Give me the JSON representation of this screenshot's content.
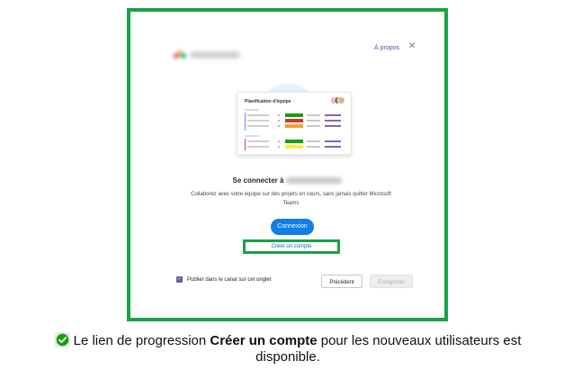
{
  "dialog": {
    "about_label": "À propos",
    "close_glyph": "✕",
    "card": {
      "title": "Planification d'équipe"
    },
    "connect": {
      "title_prefix": "Se connecter à",
      "description": "Collaborez avec votre équipe sur des projets en cours, sans jamais quitter Microsoft Teams"
    },
    "buttons": {
      "connexion": "Connexion",
      "create_account": "Créer un compte",
      "previous": "Précédent",
      "save": "Enregistrer"
    },
    "checkbox": {
      "label": "Publier dans le canal sur cet onglet",
      "checked": true
    }
  },
  "caption": {
    "prefix": "Le lien de progression ",
    "bold": "Créer un compte",
    "suffix": " pour les nouveaux utilisateurs est disponible."
  },
  "colors": {
    "highlight": "#17a344",
    "primary": "#0f7ee6",
    "link": "#0f6cbd",
    "status_green": "#13a10e",
    "status_red": "#d13438",
    "status_orange": "#f7a035",
    "status_yellow": "#fce100",
    "accent_purple": "#8764b8"
  },
  "icons": {
    "close": "close-icon",
    "checkbox": "checkmark-icon",
    "caption": "check-circle-icon"
  }
}
